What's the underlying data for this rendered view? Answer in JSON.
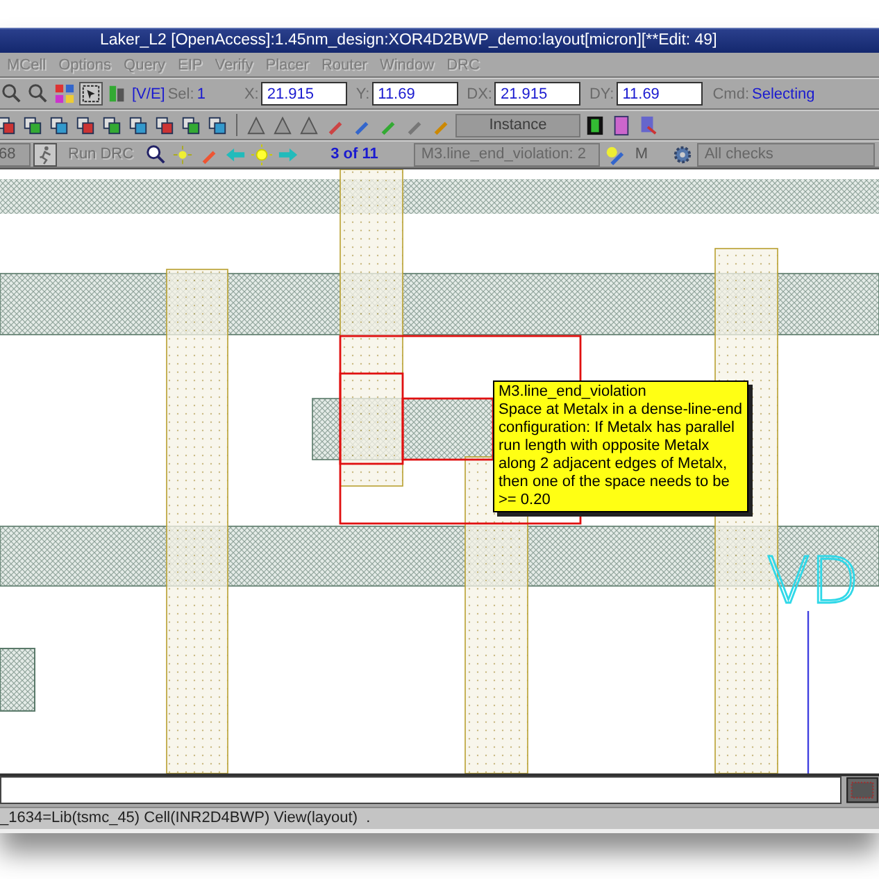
{
  "window": {
    "title": "Laker_L2 [OpenAccess]:1.45nm_design:XOR4D2BWP_demo:layout[micron][**Edit: 49]"
  },
  "menu": [
    "MCell",
    "Options",
    "Query",
    "EIP",
    "Verify",
    "Placer",
    "Router",
    "Window",
    "DRC"
  ],
  "toolbar": {
    "view_mode": "[V/E]",
    "sel_label": "Sel:",
    "sel_value": "1",
    "coords": [
      {
        "label": "X:",
        "value": "21.915"
      },
      {
        "label": "Y:",
        "value": "11.69"
      },
      {
        "label": "DX:",
        "value": "21.915"
      },
      {
        "label": "DY:",
        "value": "11.69"
      }
    ],
    "cmd_label": "Cmd:",
    "cmd_value": "Selecting"
  },
  "instance_dropdown": {
    "value": "Instance",
    "disabled": true
  },
  "drc_bar": {
    "layer_dropdown": "68",
    "run_button": {
      "label": "Run DRC",
      "disabled": true
    },
    "counter": "3 of 11",
    "violation_dropdown": "M3.line_end_violation: 2",
    "mode_dropdown": "M",
    "checks_dropdown": "All checks"
  },
  "canvas": {
    "label": "VD",
    "tooltip": {
      "title": "M3.line_end_violation",
      "body": "Space at Metalx in a dense-line-end configuration: If Metalx has parallel run length with opposite Metalx along 2 adjacent edges of Metalx, then one of the space needs to be >= 0.20"
    }
  },
  "status_bar": "_1634=Lib(tsmc_45) Cell(INR2D4BWP) View(layout)  ."
}
